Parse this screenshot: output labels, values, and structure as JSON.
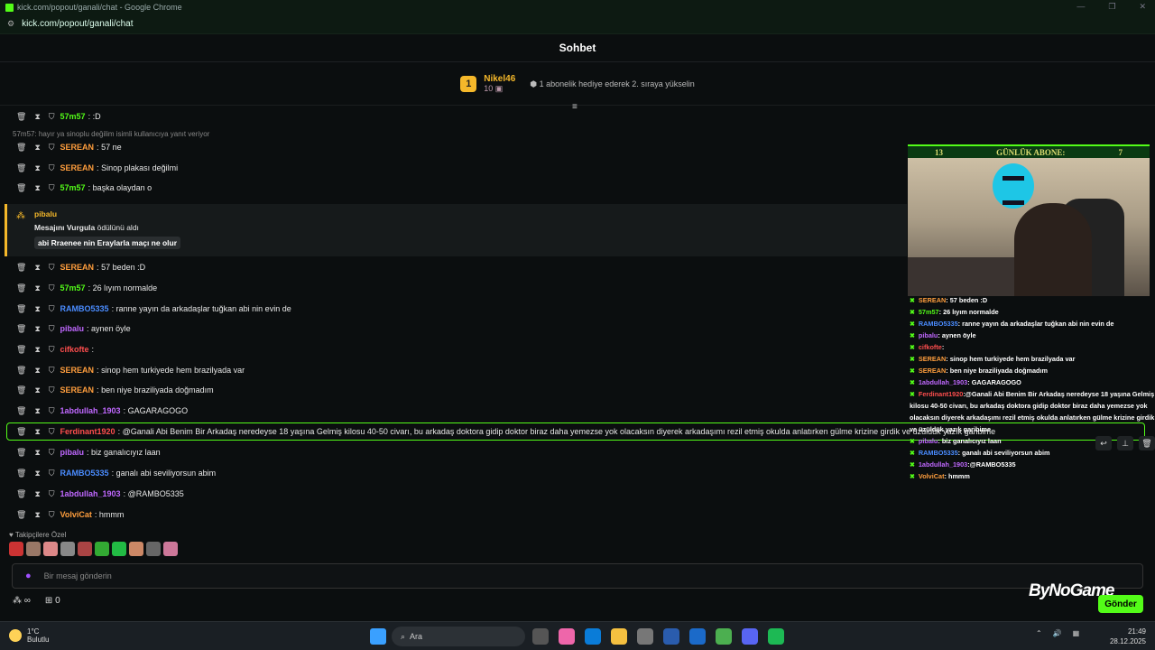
{
  "browser": {
    "title": "kick.com/popout/ganali/chat - Google Chrome",
    "url": "kick.com/popout/ganali/chat"
  },
  "header": {
    "title": "Sohbet"
  },
  "top_gifter": {
    "rank": "1",
    "name": "Nikel46",
    "count": "10",
    "hint": "1 abonelik hediye ederek 2. sıraya yükselin"
  },
  "reply_note": "57m57: hayır ya sinoplu değilim isimli kullanıcıya yanıt veriyor",
  "messages": [
    {
      "user": "57m57",
      "color": "#53fc18",
      "text": ":D"
    },
    {
      "user": "SEREAN",
      "color": "#ff9e3d",
      "text": "57 ne"
    },
    {
      "user": "SEREAN",
      "color": "#ff9e3d",
      "text": "Sinop plakası değilmi"
    },
    {
      "user": "57m57",
      "color": "#53fc18",
      "text": "başka olaydan o"
    },
    {
      "user": "SEREAN",
      "color": "#ff9e3d",
      "text": "57 beden :D"
    },
    {
      "user": "57m57",
      "color": "#53fc18",
      "text": "26 lıyım normalde"
    },
    {
      "user": "RAMBO5335",
      "color": "#4a8cff",
      "text": "ranne yayın da arkadaşlar tuğkan abi nin evin de"
    },
    {
      "user": "pibalu",
      "color": "#c068ff",
      "text": "aynen öyle"
    },
    {
      "user": "cifkofte",
      "color": "#ff4e4e",
      "text": ""
    },
    {
      "user": "SEREAN",
      "color": "#ff9e3d",
      "text": "sinop hem turkiyede hem brazilyada var"
    },
    {
      "user": "SEREAN",
      "color": "#ff9e3d",
      "text": "ben niye braziliyada doğmadım"
    },
    {
      "user": "1abdullah_1903",
      "color": "#c068ff",
      "text": "GAGARAGOGO"
    },
    {
      "user": "Ferdinant1920",
      "color": "#ff4e4e",
      "text": "@Ganali Abi Benim Bir Arkadaş neredeyse 18 yaşına Gelmiş kilosu 40-50 civarı, bu arkadaş doktora gidip doktor biraz daha yemezse yok olacaksın diyerek arkadaşımı rezil etmiş okulda anlatırken gülme krizine girdik ve üzüldük yazık garibime"
    },
    {
      "user": "pibalu",
      "color": "#c068ff",
      "text": "biz ganalıcıyız laan"
    },
    {
      "user": "RAMBO5335",
      "color": "#4a8cff",
      "text": "ganalı abi seviliyorsun abim"
    },
    {
      "user": "1abdullah_1903",
      "color": "#c068ff",
      "text": "@RAMBO5335"
    },
    {
      "user": "VolviCat",
      "color": "#ff9e3d",
      "text": "hmmm"
    }
  ],
  "highlight": {
    "user": "pibalu",
    "line2_bold": "Mesajını Vurgula",
    "line2_rest": " ödülünü aldı",
    "quote": "abi Rraenee nin Eraylarla maçı ne olur"
  },
  "emotes_label": "Takipçilere Özel",
  "input": {
    "placeholder": "Bir mesaj gönderin"
  },
  "bottom": {
    "infinity": "∞",
    "gift_count": "0"
  },
  "send_label": "Gönder",
  "watermark": "ByNoGame",
  "overlay": {
    "banner_left": "13",
    "banner_title": "GÜNLÜK ABONE:",
    "banner_right": "7",
    "lines": [
      {
        "user": "SEREAN",
        "color": "#ff9e3d",
        "text": " : 57 beden :D"
      },
      {
        "user": "57m57",
        "color": "#53fc18",
        "text": " : 26 lıyım normalde"
      },
      {
        "user": "RAMBO5335",
        "color": "#4a8cff",
        "text": " : ranne yayın da arkadaşlar tuğkan abi nin evin de"
      },
      {
        "user": "pibalu",
        "color": "#c068ff",
        "text": " : aynen öyle"
      },
      {
        "user": "cifkofte",
        "color": "#ff4e4e",
        "text": " :"
      },
      {
        "user": "SEREAN",
        "color": "#ff9e3d",
        "text": " : sinop hem turkiyede hem brazilyada var"
      },
      {
        "user": "SEREAN",
        "color": "#ff9e3d",
        "text": " : ben niye braziliyada doğmadım"
      },
      {
        "user": "1abdullah_1903",
        "color": "#c068ff",
        "text": " : GAGARAGOGO"
      },
      {
        "user": "Ferdinant1920",
        "color": "#ff4e4e",
        "text": " :@Ganali Abi Benim Bir Arkadaş neredeyse 18 yaşına Gelmiş"
      },
      {
        "user": "",
        "color": "#fff",
        "text": "kilosu 40-50 civarı, bu arkadaş doktora gidip doktor biraz daha yemezse yok"
      },
      {
        "user": "",
        "color": "#fff",
        "text": "olacaksın diyerek arkadaşımı rezil etmiş okulda anlatırken gülme krizine girdik"
      },
      {
        "user": "",
        "color": "#fff",
        "text": "ve üzüldük yazık garibime"
      },
      {
        "user": "pibalu",
        "color": "#c068ff",
        "text": " : biz ganalıcıyız laan"
      },
      {
        "user": "RAMBO5335",
        "color": "#4a8cff",
        "text": " : ganalı abi seviliyorsun abim"
      },
      {
        "user": "1abdullah_1903",
        "color": "#c068ff",
        "text": " :@RAMBO5335"
      },
      {
        "user": "VolviCat",
        "color": "#ff9e3d",
        "text": " : hmmm"
      }
    ]
  },
  "taskbar": {
    "temp": "1°C",
    "weather": "Bulutlu",
    "search": "Ara",
    "time": "21:49",
    "date": "28.12.2025"
  }
}
